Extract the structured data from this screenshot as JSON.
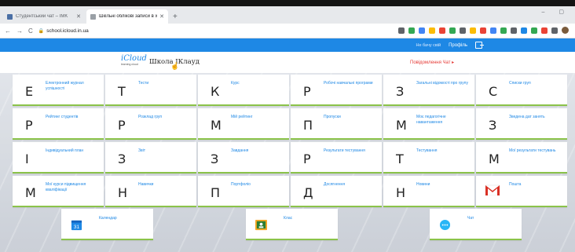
{
  "browser": {
    "tabs": [
      {
        "label": "Студентський чат – IMK",
        "favicon_color": "#4a6fa5",
        "active": false
      },
      {
        "label": "Шкільні облікові записи в хмарі",
        "favicon_color": "#9aa0a6",
        "active": true
      }
    ],
    "new_tab": "+",
    "url": "school.icloud.in.ua",
    "extension_colors": [
      "#5f6368",
      "#34a853",
      "#4285f4",
      "#fbbc05",
      "#ea4335",
      "#34a853",
      "#5f6368",
      "#fbbc05",
      "#ea4335",
      "#4285f4",
      "#34a853",
      "#5f6368",
      "#1e88e5",
      "#34a853",
      "#ea4335",
      "#5f6368"
    ]
  },
  "topbar": {
    "help_link": "Не бачу свій",
    "profile": "Профіль"
  },
  "header": {
    "logo_text": "iCloud",
    "logo_sub": "learning cloud",
    "title": "Школа ІКлауд",
    "chat_link": "Повідомлення Чат ▸"
  },
  "tiles": [
    {
      "letter": "Е",
      "label": "Електронний журнал успішності"
    },
    {
      "letter": "Т",
      "label": "Тести"
    },
    {
      "letter": "К",
      "label": "Курс"
    },
    {
      "letter": "Р",
      "label": "Робочі навчальні програми"
    },
    {
      "letter": "З",
      "label": "Загальні відомості про групу"
    },
    {
      "letter": "С",
      "label": "Списки груп"
    },
    {
      "letter": "Р",
      "label": "Рейтинг студентів"
    },
    {
      "letter": "Р",
      "label": "Розклад груп"
    },
    {
      "letter": "М",
      "label": "Мій рейтинг"
    },
    {
      "letter": "П",
      "label": "Пропуски"
    },
    {
      "letter": "М",
      "label": "Моє педагогічне навантаження"
    },
    {
      "letter": "З",
      "label": "Зведена дат занять"
    },
    {
      "letter": "І",
      "label": "Індивідуальний план"
    },
    {
      "letter": "З",
      "label": "Звіт"
    },
    {
      "letter": "З",
      "label": "Завдання"
    },
    {
      "letter": "Р",
      "label": "Результати тестування"
    },
    {
      "letter": "Т",
      "label": "Тестування"
    },
    {
      "letter": "М",
      "label": "Мої результати тестувань"
    },
    {
      "letter": "М",
      "label": "Мої курси підвищення кваліфікації"
    },
    {
      "letter": "Н",
      "label": "Навички"
    },
    {
      "letter": "П",
      "label": "Портфоліо"
    },
    {
      "letter": "Д",
      "label": "Досягнення"
    },
    {
      "letter": "Н",
      "label": "Новини"
    },
    {
      "letter": "",
      "label": "Пошта",
      "icon": "gmail-icon"
    }
  ],
  "bottom_tiles": [
    {
      "label": "Календар",
      "icon": "calendar-icon"
    },
    {
      "label": "Клас",
      "icon": "classroom-icon"
    },
    {
      "label": "Чат",
      "icon": "chat-icon"
    }
  ],
  "colors": {
    "accent": "#1e88e5",
    "tile_border": "#8bc34a",
    "chat_link": "#e53935"
  }
}
